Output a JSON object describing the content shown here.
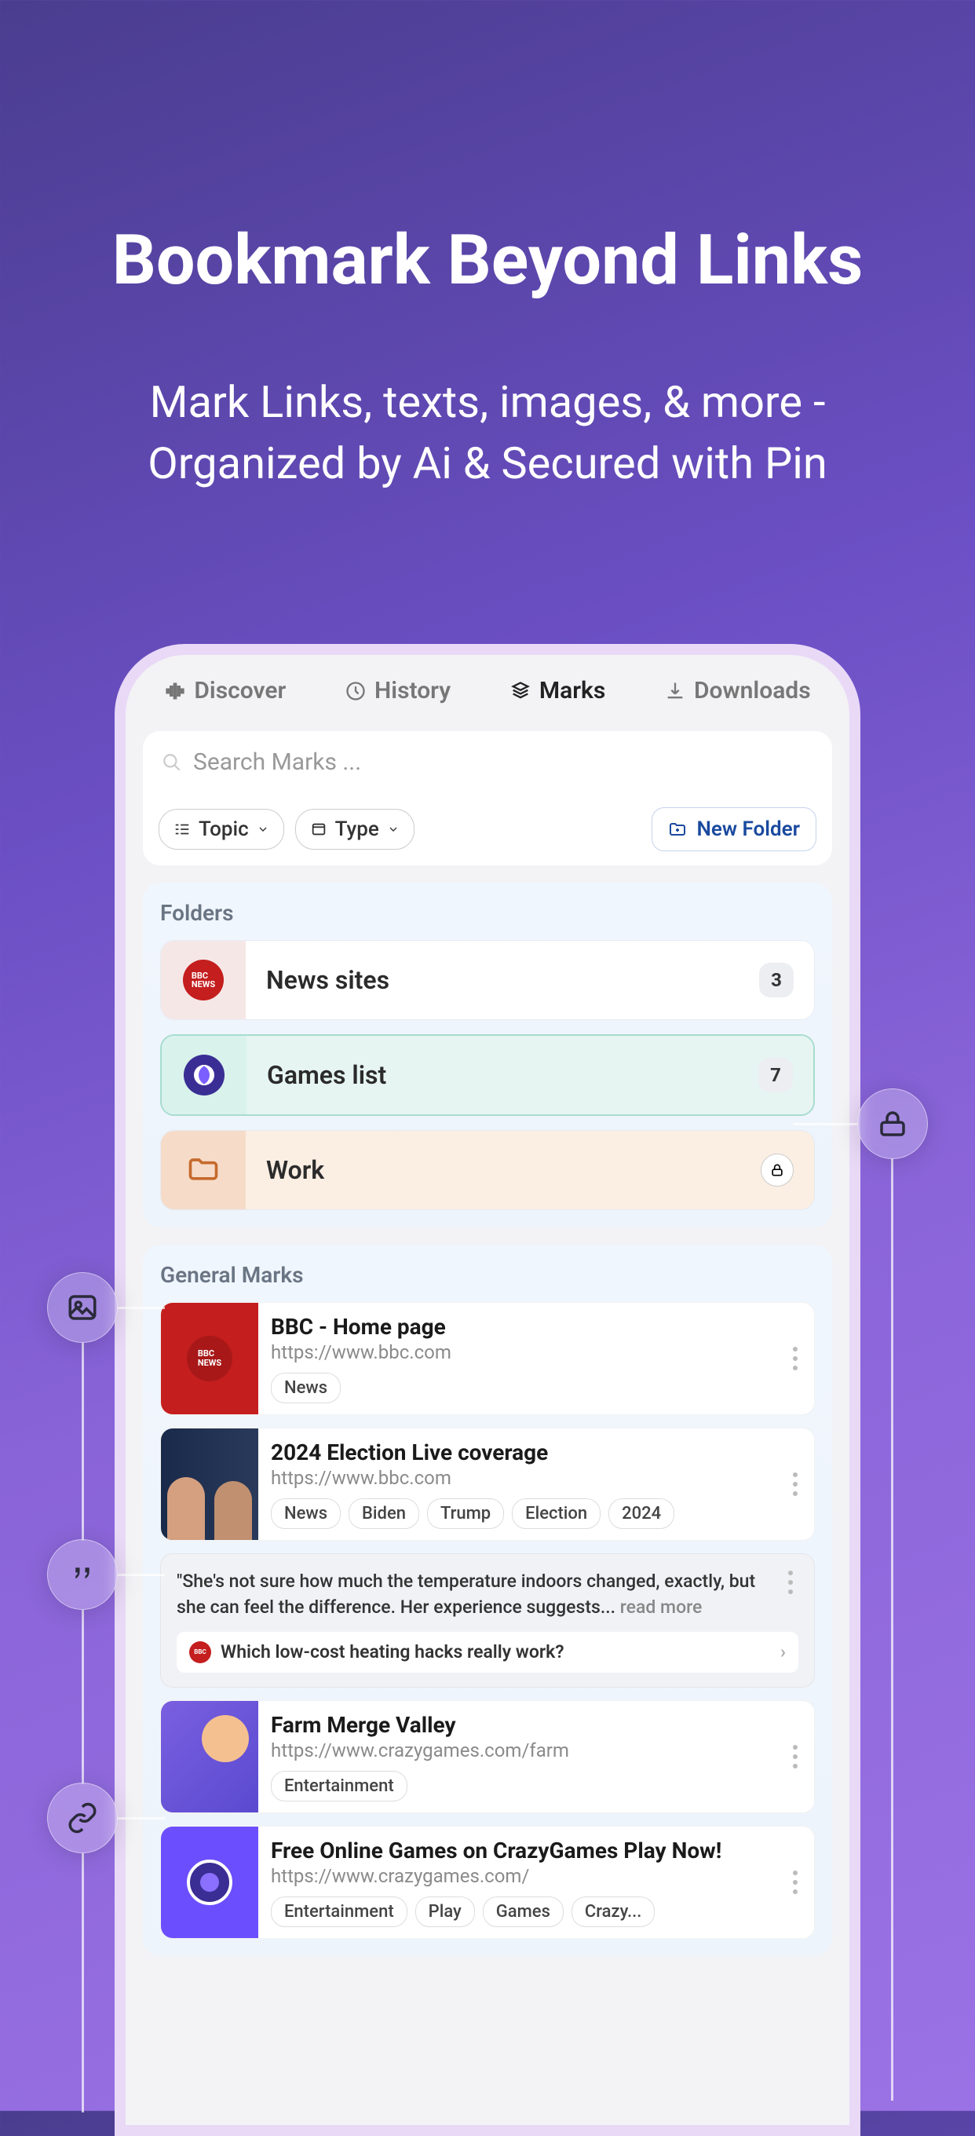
{
  "hero": {
    "title": "Bookmark Beyond Links",
    "subtitle": "Mark Links, texts, images, & more - Organized by Ai & Secured with Pin"
  },
  "tabs": {
    "discover": "Discover",
    "history": "History",
    "marks": "Marks",
    "downloads": "Downloads"
  },
  "search": {
    "placeholder": "Search Marks ..."
  },
  "filters": {
    "topic": "Topic",
    "type": "Type",
    "new_folder": "New Folder"
  },
  "sections": {
    "folders_title": "Folders",
    "general_title": "General Marks"
  },
  "folders": [
    {
      "name": "News sites",
      "count": "3"
    },
    {
      "name": "Games list",
      "count": "7"
    },
    {
      "name": "Work"
    }
  ],
  "marks": {
    "bbc": {
      "title": "BBC - Home page",
      "url": "https://www.bbc.com",
      "tags": [
        "News"
      ]
    },
    "election": {
      "title": "2024 Election Live coverage",
      "url": "https://www.bbc.com",
      "tags": [
        "News",
        "Biden",
        "Trump",
        "Election",
        "2024"
      ]
    },
    "quote": {
      "text": "\"She's not sure how much the temperature indoors changed, exactly, but she can feel the difference. Her experience suggests...",
      "readmore": " read more",
      "source": "Which low-cost heating hacks really work?"
    },
    "farm": {
      "title": "Farm Merge Valley",
      "url": "https://www.crazygames.com/farm",
      "tags": [
        "Entertainment"
      ]
    },
    "crazy": {
      "title": "Free Online Games on CrazyGames Play Now!",
      "url": "https://www.crazygames.com/",
      "tags": [
        "Entertainment",
        "Play",
        "Games",
        "Crazy..."
      ]
    }
  }
}
